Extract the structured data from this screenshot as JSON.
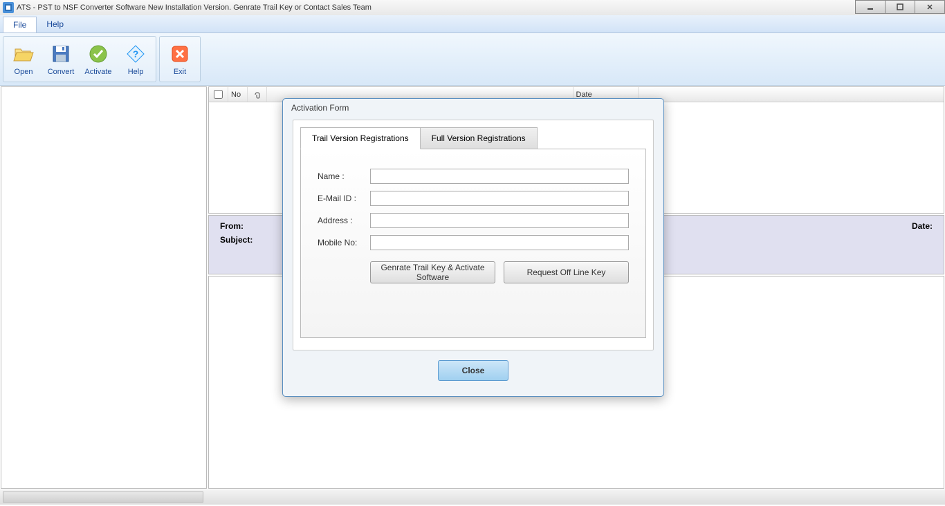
{
  "window": {
    "title": "ATS - PST to NSF Converter Software New Installation Version. Genrate Trail Key or Contact Sales Team"
  },
  "menu": {
    "file": "File",
    "help": "Help"
  },
  "toolbar": {
    "open": "Open",
    "convert": "Convert",
    "activate": "Activate",
    "help": "Help",
    "exit": "Exit"
  },
  "grid": {
    "no": "No",
    "date": "Date"
  },
  "info": {
    "from": "From:",
    "subject": "Subject:",
    "date": "Date:"
  },
  "dialog": {
    "title": "Activation Form",
    "tab_trail": "Trail Version Registrations",
    "tab_full": "Full Version Registrations",
    "form": {
      "name": "Name :",
      "email": "E-Mail ID :",
      "address": "Address :",
      "mobile": "Mobile No:"
    },
    "btn_generate": "Genrate Trail Key & Activate Software",
    "btn_offline": "Request Off Line Key",
    "btn_close": "Close"
  }
}
